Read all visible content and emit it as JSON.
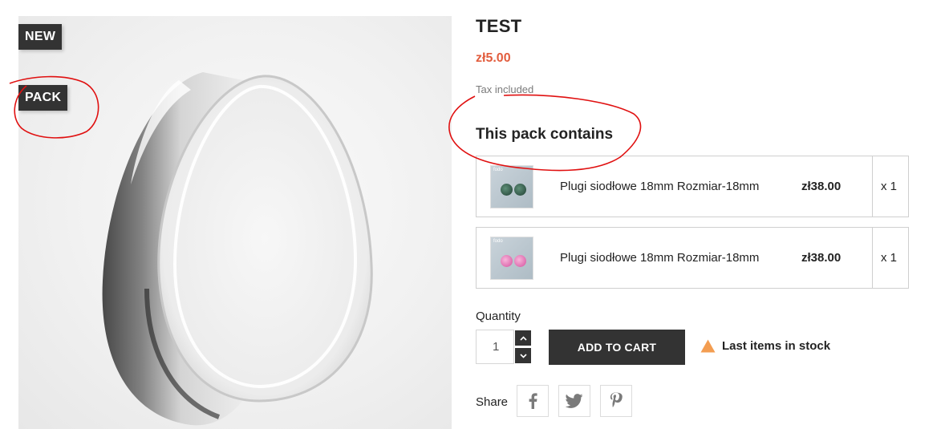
{
  "flags": {
    "new": "NEW",
    "pack": "PACK"
  },
  "product": {
    "title": "TEST",
    "price": "zł5.00",
    "tax_note": "Tax included"
  },
  "pack": {
    "heading": "This pack contains",
    "items": [
      {
        "name": "Plugi siodłowe 18mm Rozmiar-18mm",
        "price": "zł38.00",
        "quantity": "x 1",
        "thumb_color": "#2f5a48",
        "thumb_icon": "green-plugs-thumbnail"
      },
      {
        "name": "Plugi siodłowe 18mm Rozmiar-18mm",
        "price": "zł38.00",
        "quantity": "x 1",
        "thumb_color": "#e680b8",
        "thumb_icon": "pink-plugs-thumbnail"
      }
    ]
  },
  "quantity": {
    "label": "Quantity",
    "value": "1"
  },
  "cart": {
    "add_label": "ADD TO CART"
  },
  "stock": {
    "message": "Last items in stock",
    "icon": "warning-icon",
    "icon_color": "#f39d51"
  },
  "share": {
    "label": "Share",
    "networks": [
      "facebook-icon",
      "twitter-icon",
      "pinterest-icon"
    ]
  },
  "colors": {
    "accent_price": "#e25d3e",
    "dark": "#333333",
    "annotation": "#e01010"
  }
}
